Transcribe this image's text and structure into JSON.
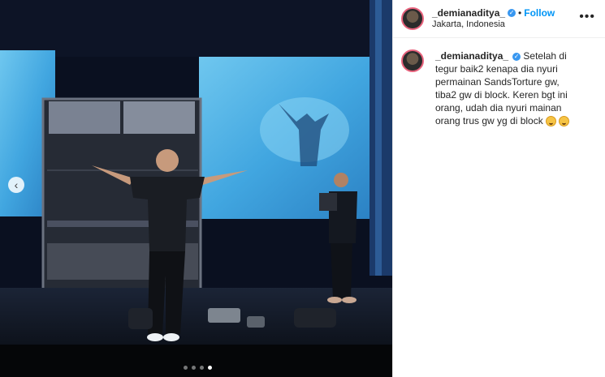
{
  "post": {
    "username": "_demianaditya_",
    "follow_label": "Follow",
    "location": "Jakarta, Indonesia",
    "more_label": "•••"
  },
  "caption": {
    "username": "_demianaditya_",
    "text": "Setelah di tegur baik2 kenapa dia nyuri permainan SandsTorture gw, tiba2 gw di block. Keren bgt ini orang, udah dia nyuri mainan orang trus gw yg di block"
  },
  "carousel": {
    "slides": 4,
    "active_index": 3,
    "prev_icon": "chevron-left-icon"
  },
  "colors": {
    "link": "#0095f6",
    "verified": "#3897f0",
    "avatar_ring": "#e8637d"
  }
}
